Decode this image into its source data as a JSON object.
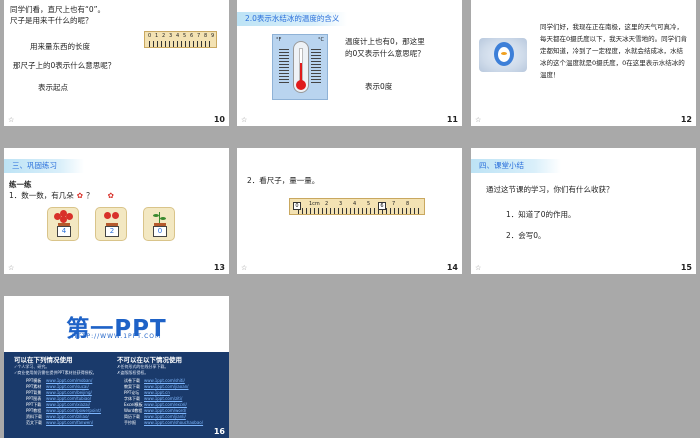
{
  "slides": [
    {
      "number": "10",
      "q1": "同学们看，直尺上也有“0”。",
      "q2": "尺子是用来干什么的呢？",
      "a1": "用来量东西的长度",
      "q3": "那尺子上的0表示什么意思呢？",
      "a2": "表示起点",
      "ruler_labels": [
        "0",
        "1",
        "2",
        "3",
        "4",
        "5",
        "6",
        "7",
        "8",
        "9"
      ]
    },
    {
      "number": "11",
      "title": "2.0表示水结冰的温度的含义",
      "unit_f": "°F",
      "unit_c": "°C",
      "question1": "温度计上也有0，那这里",
      "question2": "的0又表示什么意思呢？",
      "answer": "表示0度"
    },
    {
      "number": "12",
      "line1": "同学们好，我现在正在南极，这里的天气可真冷，",
      "line2": "每天都在0摄氏度以下，我天冰天雪地的。同学们肯",
      "line3": "定都知道，冷到了一定程度，水就会结成冰，水结",
      "line4": "冰的这个温度就是0摄氏度，0在这里表示水结冰的",
      "line5": "温度！"
    },
    {
      "number": "13",
      "title": "三、巩固练习",
      "subtitle": "练一练",
      "prompt": "1．数一数，有几朵",
      "prompt_end": "？",
      "answers": [
        "4",
        "2",
        "0"
      ]
    },
    {
      "number": "14",
      "prompt": "2．看尺子，量一量。",
      "ruler_start": "0",
      "ruler_unit": "1cm",
      "ruler_labels": [
        "2",
        "3",
        "4",
        "5",
        "6",
        "7",
        "8"
      ],
      "ruler_mark": "6"
    },
    {
      "number": "15",
      "title": "四、课堂小结",
      "question": "通过这节课的学习，你们有什么收获？",
      "point1": "1．知道了0的作用。",
      "point2": "2．会写0。"
    },
    {
      "number": "16",
      "logo": "第一PPT",
      "url": "HTTP://WWW.1PPT.COM",
      "can_use_title": "可以在下列情况使用",
      "can_use_notes": [
        "✓个人学习、研究。",
        "✓商业使用前仍需在提供PPT素材处获得授权。"
      ],
      "cannot_use_title": "不可以在以下情况使用",
      "cannot_use_notes": [
        "✗任何形式的在线分享下载。",
        "✗盗版版权侵权。"
      ],
      "left_links": [
        {
          "k": "PPT模板",
          "v": "www.1ppt.com/moban/"
        },
        {
          "k": "PPT素材",
          "v": "www.1ppt.com/sucai/"
        },
        {
          "k": "PPT背景",
          "v": "www.1ppt.com/beijing/"
        },
        {
          "k": "PPT图表",
          "v": "www.1ppt.com/tubiao/"
        },
        {
          "k": "PPT下载",
          "v": "www.1ppt.com/xiazai/"
        },
        {
          "k": "PPT教程",
          "v": "www.1ppt.com/powerpoint/"
        },
        {
          "k": "资料下载",
          "v": "www.1ppt.com/ziliao/"
        },
        {
          "k": "范文下载",
          "v": "www.1ppt.com/fanwen/"
        }
      ],
      "right_links": [
        {
          "k": "试卷下载",
          "v": "www.1ppt.com/shiti/"
        },
        {
          "k": "教案下载",
          "v": "www.1ppt.com/jiaoan/"
        },
        {
          "k": "PPT论坛",
          "v": "www.1ppt.cn"
        },
        {
          "k": "字体下载",
          "v": "www.1ppt.com/ziti/"
        },
        {
          "k": "Excel模板",
          "v": "www.1ppt.com/excel/"
        },
        {
          "k": "Word教程",
          "v": "www.1ppt.com/word/"
        },
        {
          "k": "简历下载",
          "v": "www.1ppt.com/jianli/"
        },
        {
          "k": "手抄报",
          "v": "www.1ppt.com/shouchaobao/"
        }
      ]
    }
  ]
}
